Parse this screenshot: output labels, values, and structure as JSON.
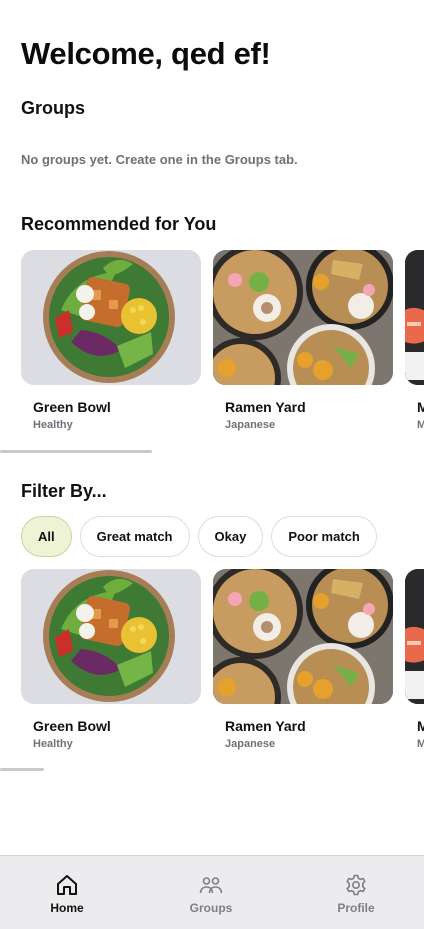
{
  "header": {
    "welcome": "Welcome, qed ef!"
  },
  "groups": {
    "title": "Groups",
    "empty_message": "No groups yet. Create one in the Groups tab."
  },
  "recommended": {
    "title": "Recommended for You",
    "cards": [
      {
        "name": "Green Bowl",
        "cuisine": "Healthy"
      },
      {
        "name": "Ramen Yard",
        "cuisine": "Japanese"
      },
      {
        "name": "M",
        "cuisine": "M"
      }
    ]
  },
  "filter": {
    "title": "Filter By...",
    "chips": [
      "All",
      "Great match",
      "Okay",
      "Poor match"
    ],
    "selected": "All",
    "cards": [
      {
        "name": "Green Bowl",
        "cuisine": "Healthy"
      },
      {
        "name": "Ramen Yard",
        "cuisine": "Japanese"
      },
      {
        "name": "M",
        "cuisine": "M"
      }
    ]
  },
  "tabbar": {
    "items": [
      {
        "label": "Home",
        "icon": "home-icon"
      },
      {
        "label": "Groups",
        "icon": "groups-icon"
      },
      {
        "label": "Profile",
        "icon": "gear-icon"
      }
    ],
    "active": "Home"
  },
  "colors": {
    "chip_active_bg": "#eef3d6",
    "chip_active_border": "#c8d79a",
    "muted_text": "#6f7178",
    "tabbar_bg": "#ececee"
  }
}
